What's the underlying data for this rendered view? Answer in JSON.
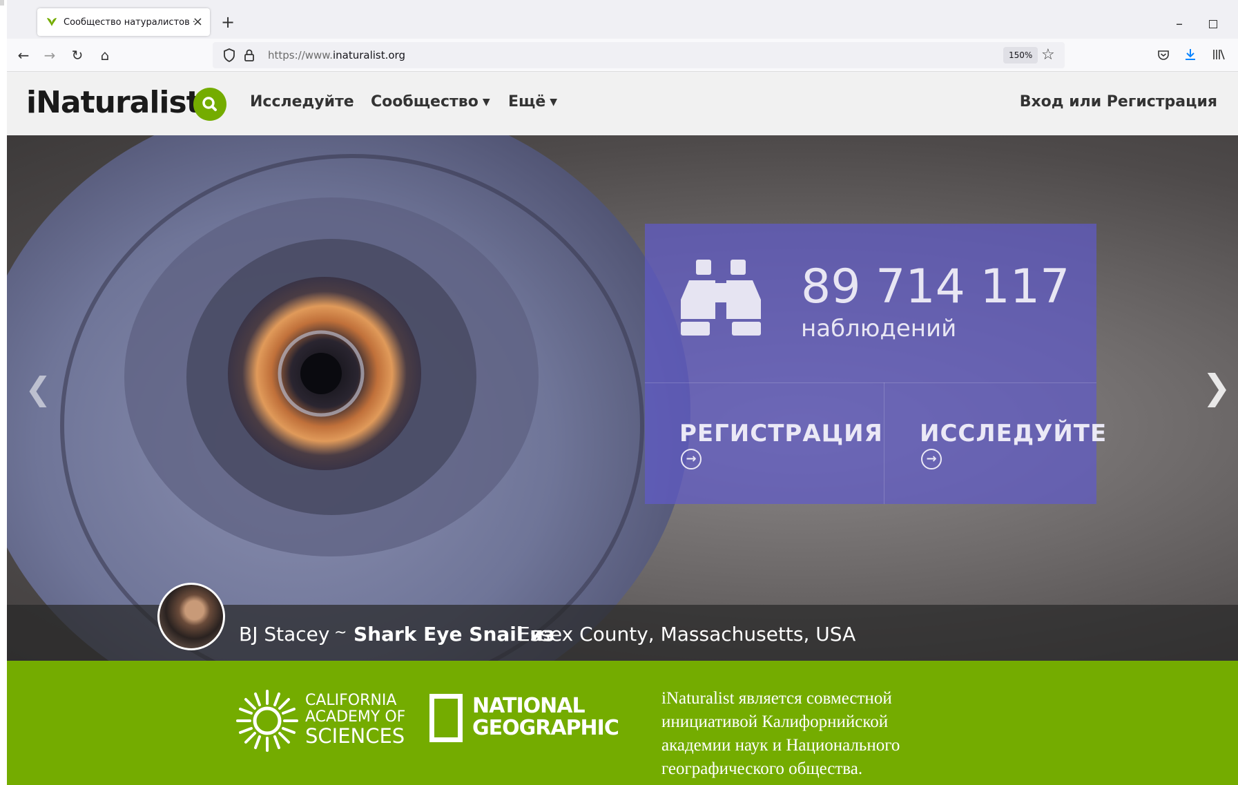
{
  "browser": {
    "tab_title": "Сообщество натуралистов · iN",
    "url_host_prefix": "https://www.",
    "url_host_domain": "inaturalist.org",
    "zoom": "150%"
  },
  "site": {
    "logo": "iNaturalist",
    "nav": {
      "explore": "Исследуйте",
      "community": "Сообщество",
      "more": "Ещё",
      "login": "Вход или Регистрация"
    }
  },
  "hero": {
    "observations_count": "89 714 117",
    "observations_label": "наблюдений",
    "cta_signup": "РЕГИСТРАЦИЯ",
    "cta_explore": "ИССЛЕДУЙТЕ",
    "caption": {
      "observer": "BJ Stacey",
      "separator": "~",
      "taxon": "Shark Eye Snail из",
      "place": "Essex County, Massachusetts, USA"
    }
  },
  "footer": {
    "cas_line1": "CALIFORNIA",
    "cas_line2": "ACADEMY OF",
    "cas_line3": "SCIENCES",
    "ng_line1": "NATIONAL",
    "ng_line2": "GEOGRAPHIC",
    "about": "iNaturalist является совместной инициативой Калифорнийской академии наук и Национального географического общества."
  },
  "colors": {
    "brand_green": "#74ac00",
    "stat_panel": "#5f5ac8"
  }
}
